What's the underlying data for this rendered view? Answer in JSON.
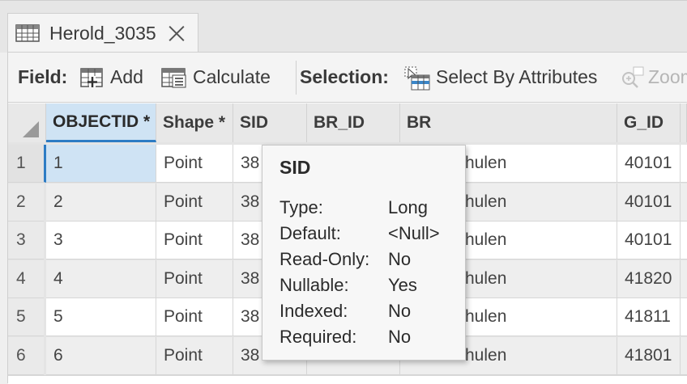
{
  "tab": {
    "title": "Herold_3035",
    "icon": "table-icon"
  },
  "toolbar": {
    "field_label": "Field:",
    "add_label": "Add",
    "calculate_label": "Calculate",
    "selection_label": "Selection:",
    "select_by_attributes_label": "Select By Attributes",
    "zoom_label": "Zoom"
  },
  "columns": [
    "OBJECTID *",
    "Shape *",
    "SID",
    "BR_ID",
    "BR",
    "G_ID"
  ],
  "rows": [
    {
      "num": "1",
      "objectid": "1",
      "shape": "Point",
      "sid": "38",
      "br": "hulen",
      "g_id": "40101"
    },
    {
      "num": "2",
      "objectid": "2",
      "shape": "Point",
      "sid": "38",
      "br": "hulen",
      "g_id": "40101"
    },
    {
      "num": "3",
      "objectid": "3",
      "shape": "Point",
      "sid": "38",
      "br": "hulen",
      "g_id": "40101"
    },
    {
      "num": "4",
      "objectid": "4",
      "shape": "Point",
      "sid": "38",
      "br": "hulen",
      "g_id": "41820"
    },
    {
      "num": "5",
      "objectid": "5",
      "shape": "Point",
      "sid": "38",
      "br": "hulen",
      "g_id": "41811"
    },
    {
      "num": "6",
      "objectid": "6",
      "shape": "Point",
      "sid": "38",
      "br": "hulen",
      "g_id": "41801"
    }
  ],
  "tooltip": {
    "title": "SID",
    "props": [
      {
        "key": "Type:",
        "value": "Long"
      },
      {
        "key": "Default:",
        "value": "<Null>"
      },
      {
        "key": "Read-Only:",
        "value": "No"
      },
      {
        "key": "Nullable:",
        "value": "Yes"
      },
      {
        "key": "Indexed:",
        "value": "No"
      },
      {
        "key": "Required:",
        "value": "No"
      }
    ]
  },
  "colors": {
    "accent": "#2d7cc4",
    "selected_bg": "#cfe3f4"
  }
}
